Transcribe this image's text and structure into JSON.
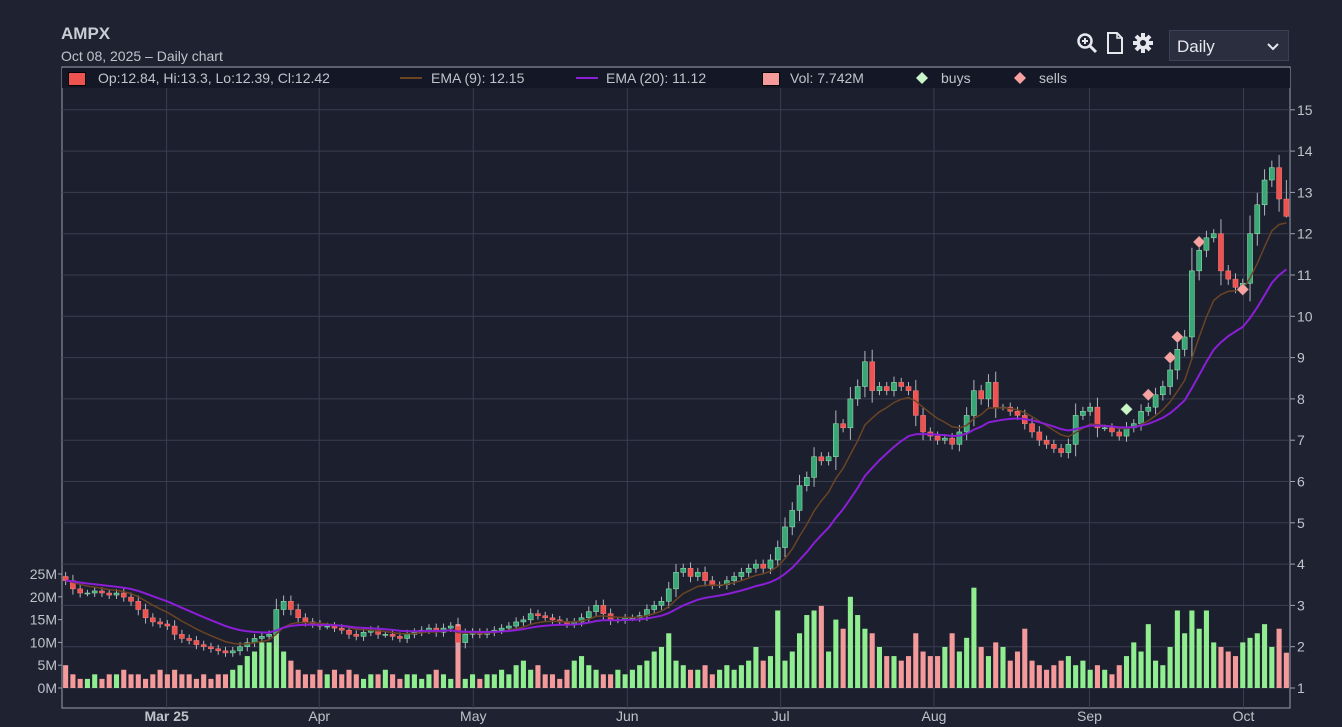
{
  "header": {
    "symbol": "AMPX",
    "subtitle": "Oct 08, 2025 – Daily chart"
  },
  "toolbar": {
    "icons": [
      "zoom-in-icon",
      "document-icon",
      "gear-icon"
    ],
    "interval_selected": "Daily"
  },
  "legend": {
    "ohlc": "Op:12.84, Hi:13.3, Lo:12.39, Cl:12.42",
    "ema9": "EMA (9): 12.15",
    "ema20": "EMA (20): 11.12",
    "vol": "Vol: 7.742M",
    "buys": "buys",
    "sells": "sells"
  },
  "colors": {
    "up": "#8ee88e",
    "down": "#ef5350",
    "vol_up": "#90ee90",
    "vol_down": "#f59a9a",
    "ema9": "#6b4423",
    "ema20": "#8a1fd6",
    "buy": "#c9f7c9",
    "sell": "#f7a1a1",
    "grid": "#3a3f50"
  },
  "chart_data": {
    "type": "candlestick",
    "title": "AMPX",
    "y_ticks": [
      "1",
      "2",
      "3",
      "4",
      "5",
      "6",
      "7",
      "8",
      "9",
      "10",
      "11",
      "12",
      "13",
      "14",
      "15"
    ],
    "ylim": [
      1,
      15
    ],
    "vol_ticks": [
      "0M",
      "5M",
      "10M",
      "15M",
      "20M",
      "25M"
    ],
    "vol_lim_millions": [
      0,
      25
    ],
    "x_ticks": [
      {
        "label": "Mar 25",
        "index": 14.4
      },
      {
        "label": "Apr",
        "index": 35.4
      },
      {
        "label": "May",
        "index": 56.6
      },
      {
        "label": "Jun",
        "index": 77.8
      },
      {
        "label": "Jul",
        "index": 98.9
      },
      {
        "label": "Aug",
        "index": 120
      },
      {
        "label": "Sep",
        "index": 141.4
      },
      {
        "label": "Oct",
        "index": 162.6
      }
    ],
    "first_open": 3.7,
    "closes": [
      3.6,
      3.4,
      3.3,
      3.3,
      3.35,
      3.3,
      3.25,
      3.3,
      3.2,
      3.1,
      2.9,
      2.7,
      2.6,
      2.55,
      2.5,
      2.3,
      2.2,
      2.15,
      2.05,
      2.0,
      1.95,
      1.9,
      1.85,
      1.9,
      2.0,
      2.1,
      2.2,
      2.25,
      2.3,
      2.9,
      3.1,
      2.9,
      2.7,
      2.6,
      2.55,
      2.5,
      2.5,
      2.45,
      2.4,
      2.3,
      2.25,
      2.35,
      2.4,
      2.3,
      2.3,
      2.25,
      2.2,
      2.3,
      2.35,
      2.4,
      2.45,
      2.35,
      2.45,
      2.5,
      2.1,
      2.3,
      2.35,
      2.3,
      2.35,
      2.4,
      2.45,
      2.5,
      2.6,
      2.65,
      2.8,
      2.75,
      2.7,
      2.65,
      2.6,
      2.55,
      2.6,
      2.7,
      2.85,
      3.0,
      2.8,
      2.65,
      2.65,
      2.7,
      2.7,
      2.75,
      2.9,
      3.0,
      3.1,
      3.4,
      3.8,
      3.9,
      3.7,
      3.8,
      3.6,
      3.5,
      3.5,
      3.6,
      3.7,
      3.8,
      3.9,
      4.0,
      3.9,
      4.1,
      4.4,
      4.9,
      5.3,
      5.9,
      6.1,
      6.6,
      6.5,
      6.6,
      7.4,
      7.3,
      8.0,
      8.3,
      8.9,
      8.2,
      8.3,
      8.2,
      8.4,
      8.3,
      8.2,
      7.6,
      7.2,
      7.1,
      7.0,
      7.05,
      6.9,
      7.2,
      7.6,
      8.2,
      8.0,
      8.4,
      7.8,
      7.8,
      7.7,
      7.6,
      7.4,
      7.2,
      7.0,
      6.9,
      6.8,
      6.7,
      6.9,
      7.6,
      7.7,
      7.8,
      7.3,
      7.3,
      7.2,
      7.1,
      7.3,
      7.4,
      7.7,
      7.8,
      8.1,
      8.3,
      8.7,
      9.2,
      9.5,
      11.1,
      11.6,
      11.9,
      12.0,
      11.1,
      10.9,
      10.7,
      10.8,
      12.0,
      12.7,
      13.3,
      13.6,
      12.84,
      12.42
    ],
    "last_bar": {
      "open": 12.84,
      "high": 13.3,
      "low": 12.39,
      "close": 12.42
    },
    "volumes_millions": [
      5,
      3,
      2,
      2,
      3,
      2,
      3,
      3,
      4,
      3,
      3,
      2,
      3,
      4,
      3,
      4,
      3,
      3,
      2,
      3,
      2,
      3,
      3,
      4,
      5,
      7,
      8,
      10,
      10,
      17,
      8,
      6,
      4,
      3,
      3,
      4,
      3,
      4,
      3,
      4,
      3,
      2,
      3,
      3,
      4,
      3,
      2,
      3,
      3,
      2,
      3,
      4,
      3,
      2,
      14,
      2,
      3,
      2,
      3,
      3,
      4,
      3,
      5,
      6,
      4,
      5,
      3,
      3,
      2,
      4,
      6,
      7,
      5,
      4,
      3,
      3,
      4,
      3,
      4,
      5,
      6,
      8,
      9,
      12,
      6,
      5,
      4,
      4,
      5,
      3,
      4,
      5,
      4,
      5,
      6,
      9,
      6,
      7,
      17,
      6,
      8,
      12,
      16,
      17,
      18,
      8,
      15,
      13,
      20,
      16,
      13,
      12,
      9,
      7,
      7,
      6,
      7,
      12,
      8,
      7,
      7,
      9,
      12,
      8,
      11,
      22,
      9,
      7,
      10,
      9,
      6,
      8,
      13,
      6,
      5,
      4,
      5,
      6,
      7,
      5,
      6,
      4,
      5,
      4,
      3,
      5,
      7,
      10,
      8,
      14,
      6,
      5,
      9,
      17,
      12,
      17,
      13,
      17,
      10,
      9,
      8,
      7,
      10,
      11,
      12,
      14,
      9,
      13,
      7.742
    ],
    "buys": [
      {
        "index": 146,
        "price": 7.75
      }
    ],
    "sells": [
      {
        "index": 149,
        "price": 8.1
      },
      {
        "index": 152,
        "price": 9.0
      },
      {
        "index": 153,
        "price": 9.5
      },
      {
        "index": 156,
        "price": 11.8
      },
      {
        "index": 162,
        "price": 10.65
      }
    ],
    "series": [
      {
        "name": "EMA (9)",
        "period": 9
      },
      {
        "name": "EMA (20)",
        "period": 20
      }
    ]
  }
}
